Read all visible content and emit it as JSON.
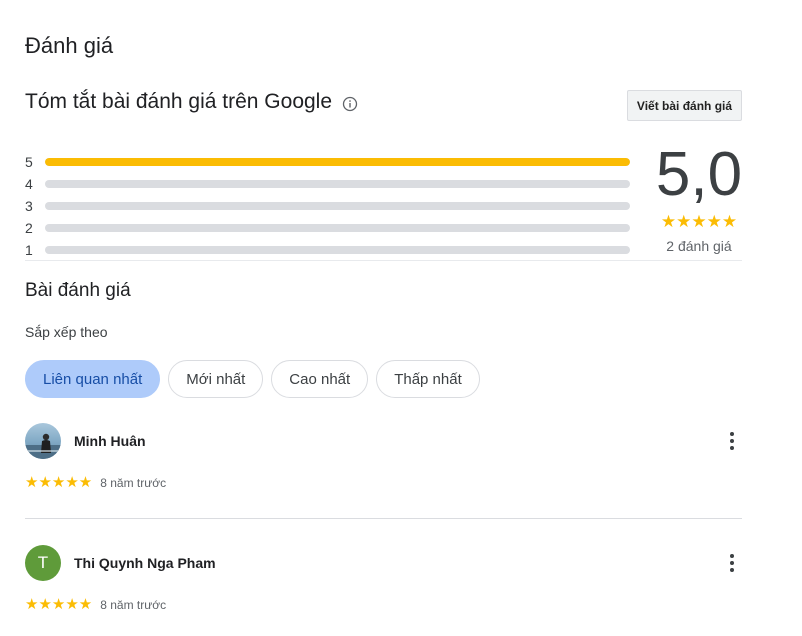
{
  "page_title": "Đánh giá",
  "summary": {
    "title": "Tóm tắt bài đánh giá trên Google",
    "info_icon": "info-icon",
    "write_review_label": "Viết bài đánh giá",
    "distribution": [
      {
        "label": "5",
        "fraction": 1.0
      },
      {
        "label": "4",
        "fraction": 0.0
      },
      {
        "label": "3",
        "fraction": 0.0
      },
      {
        "label": "2",
        "fraction": 0.0
      },
      {
        "label": "1",
        "fraction": 0.0
      }
    ],
    "average": "5,0",
    "stars": "★★★★★",
    "count_text": "2 đánh giá"
  },
  "reviews_section": {
    "title": "Bài đánh giá",
    "sort_label": "Sắp xếp theo",
    "sort_options": [
      {
        "label": "Liên quan nhất",
        "selected": true
      },
      {
        "label": "Mới nhất",
        "selected": false
      },
      {
        "label": "Cao nhất",
        "selected": false
      },
      {
        "label": "Thấp nhất",
        "selected": false
      }
    ],
    "items": [
      {
        "name": "Minh Huân",
        "avatar_type": "photo",
        "avatar_letter": "",
        "stars": "★★★★★",
        "time": "8 năm trước"
      },
      {
        "name": "Thi Quynh Nga Pham",
        "avatar_type": "letter",
        "avatar_letter": "T",
        "stars": "★★★★★",
        "time": "8 năm trước"
      }
    ]
  },
  "colors": {
    "star": "#fbbc04",
    "bar_track": "#dadce0",
    "chip_active_bg": "#aecbfa",
    "avatar_letter_bg": "#5f9b3a"
  }
}
